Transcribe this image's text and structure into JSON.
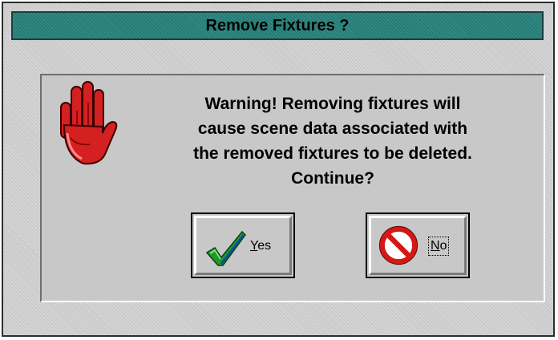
{
  "dialog": {
    "title": "Remove Fixtures ?",
    "message_lines": [
      "Warning!  Removing fixtures will",
      "cause scene data associated with",
      "the removed fixtures to be deleted.",
      "Continue?"
    ],
    "icon": "stop-hand-icon"
  },
  "buttons": {
    "yes": {
      "label_mnemonic": "Y",
      "label_rest": "es",
      "icon": "checkmark-icon"
    },
    "no": {
      "label_mnemonic": "N",
      "label_rest": "o",
      "icon": "prohibited-icon",
      "focused": true
    }
  },
  "colors": {
    "title_bar": "#2f8a84",
    "dialog_face": "#c9c9c9",
    "hand_red": "#d42020",
    "check_green": "#1f9a2a",
    "prohibit_red": "#d41818"
  }
}
